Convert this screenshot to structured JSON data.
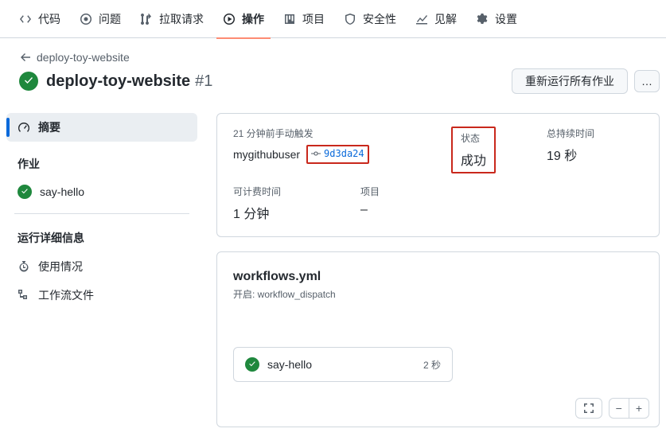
{
  "tabs": {
    "code": "代码",
    "issues": "问题",
    "pulls": "拉取请求",
    "actions": "操作",
    "projects": "项目",
    "security": "安全性",
    "insights": "见解",
    "settings": "设置"
  },
  "breadcrumb": {
    "back_to": "deploy-toy-website"
  },
  "run": {
    "workflow_name": "deploy-toy-website",
    "run_number": "#1",
    "rerun_label": "重新运行所有作业"
  },
  "sidebar": {
    "summary": "摘要",
    "jobs_heading": "作业",
    "jobs": [
      {
        "name": "say-hello"
      }
    ],
    "details_heading": "运行详细信息",
    "usage": "使用情况",
    "workflow_file": "工作流文件"
  },
  "summary": {
    "triggered": "21 分钟前手动触发",
    "actor": "mygithubuser",
    "commit_sha": "9d3da24",
    "status_label": "状态",
    "status_value": "成功",
    "duration_label": "总持续时间",
    "duration_value": "19 秒",
    "billable_label": "可计费时间",
    "billable_value": "1 分钟",
    "artifacts_label": "项目",
    "artifacts_value": "–"
  },
  "workflow_card": {
    "file": "workflows.yml",
    "on_prefix": "开启: ",
    "on_value": "workflow_dispatch",
    "job_name": "say-hello",
    "job_duration": "2 秒"
  },
  "controls": {
    "minus": "−",
    "plus": "+"
  }
}
